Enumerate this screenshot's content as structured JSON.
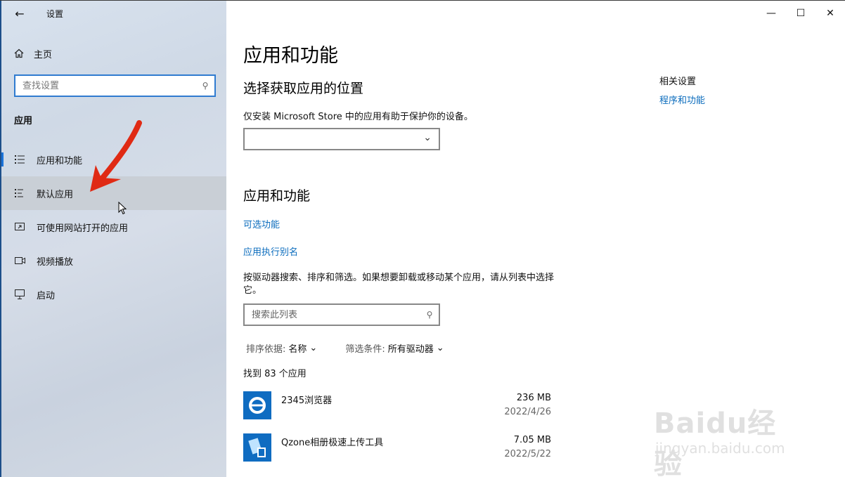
{
  "window": {
    "title": "设置",
    "controls": {
      "minimize": "—",
      "maximize": "☐",
      "close": "✕"
    }
  },
  "sidebar": {
    "home_label": "主页",
    "search_placeholder": "查找设置",
    "section_heading": "应用",
    "items": [
      {
        "label": "应用和功能",
        "icon": "apps-list-icon"
      },
      {
        "label": "默认应用",
        "icon": "default-apps-icon"
      },
      {
        "label": "可使用网站打开的应用",
        "icon": "website-app-icon"
      },
      {
        "label": "视频播放",
        "icon": "video-playback-icon"
      },
      {
        "label": "启动",
        "icon": "startup-icon"
      }
    ],
    "active_index": 0,
    "hover_index": 1
  },
  "main": {
    "page_title": "应用和功能",
    "install_section": {
      "heading": "选择获取应用的位置",
      "description": "仅安装 Microsoft Store 中的应用有助于保护你的设备。",
      "dropdown_value": ""
    },
    "apps_section": {
      "heading": "应用和功能",
      "links": [
        "可选功能",
        "应用执行别名"
      ],
      "description": "按驱动器搜索、排序和筛选。如果想要卸载或移动某个应用，请从列表中选择它。",
      "search_placeholder": "搜索此列表",
      "sort_label": "排序依据:",
      "sort_value": "名称",
      "filter_label": "筛选条件:",
      "filter_value": "所有驱动器",
      "found_text": "找到 83 个应用"
    },
    "apps": [
      {
        "name": "2345浏览器",
        "size": "236 MB",
        "date": "2022/4/26"
      },
      {
        "name": "Qzone相册极速上传工具",
        "size": "7.05 MB",
        "date": "2022/5/22"
      }
    ]
  },
  "related": {
    "heading": "相关设置",
    "link": "程序和功能"
  },
  "watermark": {
    "brand": "Baidu经验",
    "url": "jingyan.baidu.com"
  },
  "colors": {
    "accent": "#1a73d9",
    "link": "#0b6cbd",
    "annotation_arrow": "#e02a14"
  }
}
